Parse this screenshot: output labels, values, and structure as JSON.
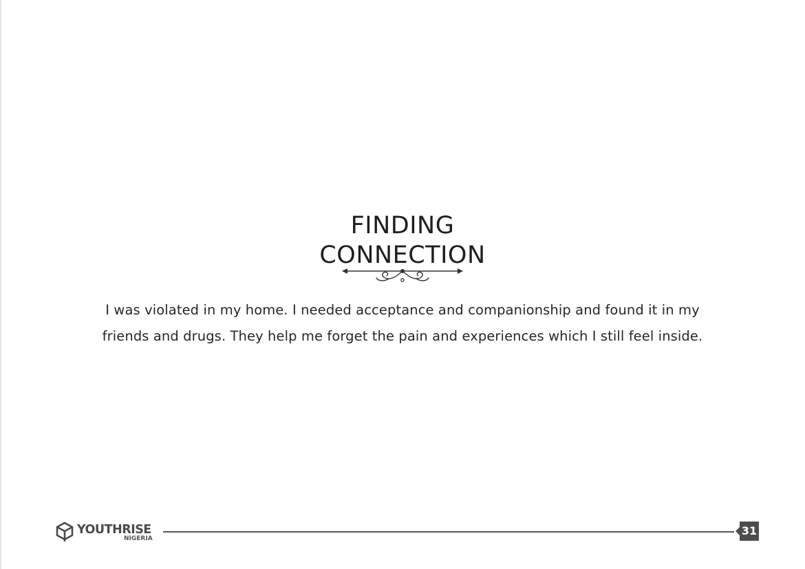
{
  "title": {
    "line1": "FINDING",
    "line2": "CONNECTION"
  },
  "body": {
    "line1": "I was violated in my home. I needed acceptance and companionship and found it in my",
    "line2": "friends and drugs. They help me forget the pain and experiences which I still feel inside."
  },
  "footer": {
    "logo_name": "YOUTHRISE",
    "logo_sub": "NIGERIA",
    "logo_icon": "cube-icon",
    "page_number": "31"
  },
  "colors": {
    "text": "#222222",
    "footer_gray": "#555555",
    "badge": "#4d4d4d"
  }
}
